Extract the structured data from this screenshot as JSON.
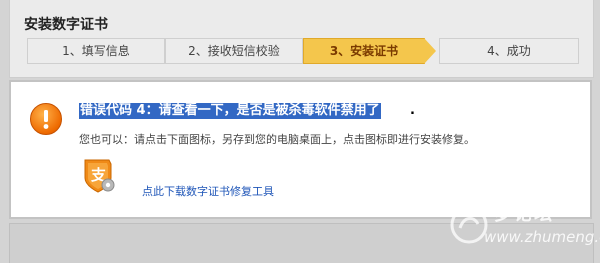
{
  "page": {
    "title": "安装数字证书"
  },
  "steps": [
    {
      "label": "1、填写信息",
      "active": false
    },
    {
      "label": "2、接收短信校验",
      "active": false
    },
    {
      "label": "3、安装证书",
      "active": true
    },
    {
      "label": "4、成功",
      "active": false
    }
  ],
  "dialog": {
    "icon": "exclamation-icon",
    "error_message": "错误代码 4：请查看一下，是否是被杀毒软件禁用了",
    "error_trailing": ".",
    "instruction": "您也可以：请点击下面图标，另存到您的电脑桌面上，点击图标即进行安装修复。",
    "tool_icon": "certificate-repair-tool-icon",
    "download_link": "点此下载数字证书修复工具"
  },
  "watermark": {
    "title": "梦论坛",
    "url": "www.zhumeng.org"
  },
  "colors": {
    "active_step": "#f4c64c",
    "error_icon": "#ee6a00",
    "highlight": "#3268c4",
    "link": "#1f56b8"
  }
}
